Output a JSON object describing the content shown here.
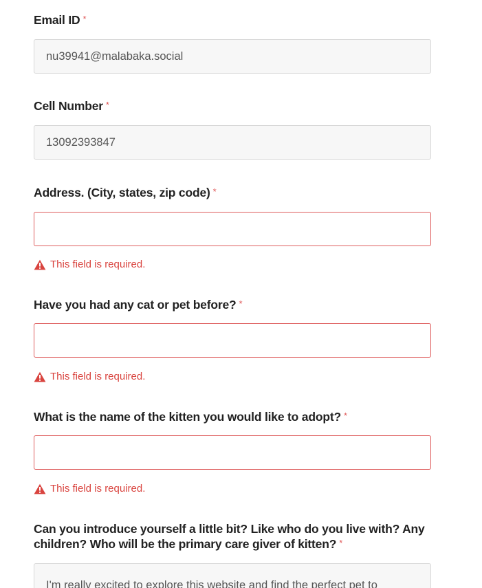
{
  "form": {
    "email": {
      "label": "Email ID",
      "required_mark": "*",
      "value": "nu39941@malabaka.social"
    },
    "cell": {
      "label": "Cell Number",
      "required_mark": "*",
      "value": "13092393847"
    },
    "address": {
      "label": "Address. (City, states, zip code)",
      "required_mark": "*",
      "value": "",
      "error": "This field is required."
    },
    "pet_before": {
      "label": "Have you had any cat or pet before?",
      "required_mark": "*",
      "value": "",
      "error": "This field is required."
    },
    "kitten_name": {
      "label": "What is the name of the kitten you would like to adopt?",
      "required_mark": "*",
      "value": "",
      "error": "This field is required."
    },
    "introduce": {
      "label_line1": "Can you introduce yourself a little bit? Like who do you live with? Any",
      "label_line2": "children? Who will be the primary care giver of kitten?",
      "required_mark": "*",
      "value": "I'm really excited to explore this website and find the perfect pet to"
    }
  },
  "colors": {
    "error": "#d9443f",
    "error_border": "#de5b5b",
    "required": "#e05a5a"
  },
  "icons": {
    "error": "warning-triangle-icon"
  }
}
